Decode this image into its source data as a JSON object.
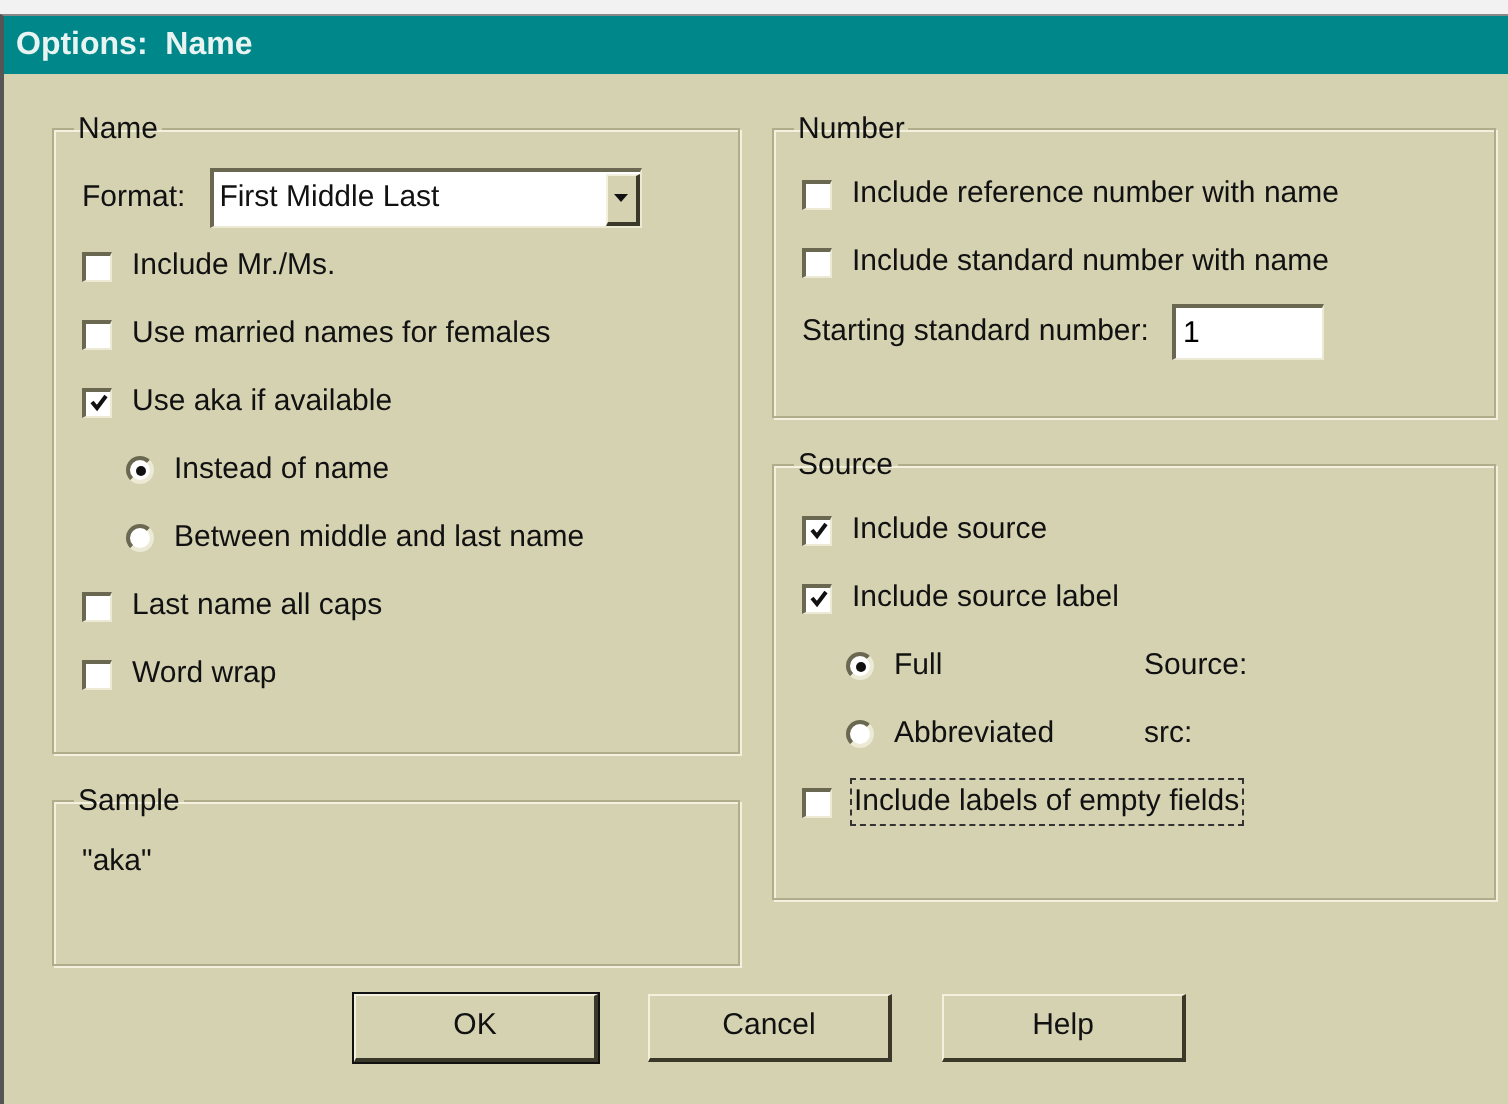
{
  "window": {
    "title": "Options:  Name"
  },
  "name_group": {
    "title": "Name",
    "format": {
      "label": "Format:",
      "value": "First Middle Last"
    },
    "options": [
      {
        "kind": "checkbox",
        "label": "Include Mr./Ms.",
        "checked": false
      },
      {
        "kind": "checkbox",
        "label": "Use married names for females",
        "checked": false
      },
      {
        "kind": "checkbox",
        "label": "Use aka if available",
        "checked": true
      },
      {
        "kind": "radio",
        "label": "Instead of name",
        "selected": true
      },
      {
        "kind": "radio",
        "label": "Between middle and last name",
        "selected": false
      },
      {
        "kind": "checkbox",
        "label": "Last name all caps",
        "checked": false
      },
      {
        "kind": "checkbox",
        "label": "Word wrap",
        "checked": false
      }
    ]
  },
  "sample": {
    "title": "Sample",
    "text": "\"aka\""
  },
  "number_group": {
    "title": "Number",
    "options": [
      {
        "kind": "checkbox",
        "label": "Include reference number with name",
        "checked": false
      },
      {
        "kind": "checkbox",
        "label": "Include standard number with name",
        "checked": false
      }
    ],
    "starting": {
      "label": "Starting standard number:",
      "value": "1"
    }
  },
  "source_group": {
    "title": "Source",
    "options": [
      {
        "kind": "checkbox",
        "label": "Include source",
        "checked": true,
        "focused": false
      },
      {
        "kind": "checkbox",
        "label": "Include source label",
        "checked": true,
        "focused": false
      },
      {
        "kind": "radio",
        "label": "Full",
        "selected": true,
        "note": "Source:"
      },
      {
        "kind": "radio",
        "label": "Abbreviated",
        "selected": false,
        "note": "src:"
      },
      {
        "kind": "checkbox",
        "label": "Include labels of empty fields",
        "checked": false,
        "focused": true
      }
    ]
  },
  "buttons": [
    {
      "label": "OK",
      "default": true
    },
    {
      "label": "Cancel",
      "default": false
    },
    {
      "label": "Help",
      "default": false
    }
  ]
}
